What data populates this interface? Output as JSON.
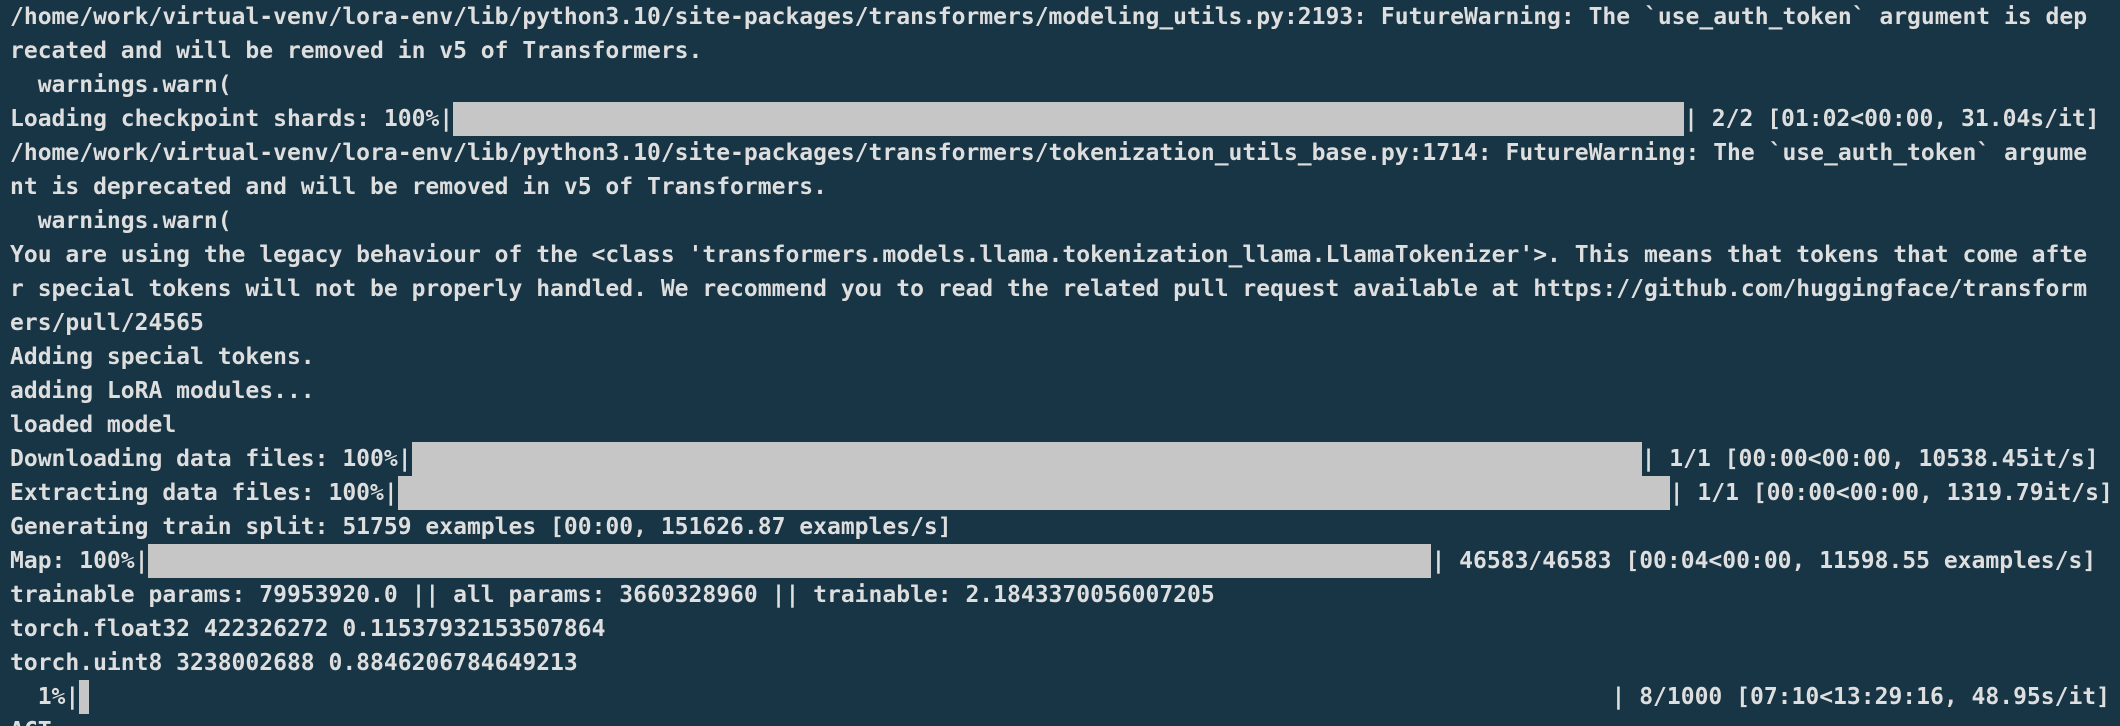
{
  "lines": {
    "l1": "/home/work/virtual-venv/lora-env/lib/python3.10/site-packages/transformers/modeling_utils.py:2193: FutureWarning: The `use_auth_token` argument is dep",
    "l2": "recated and will be removed in v5 of Transformers.",
    "l3": "  warnings.warn(",
    "l5": "/home/work/virtual-venv/lora-env/lib/python3.10/site-packages/transformers/tokenization_utils_base.py:1714: FutureWarning: The `use_auth_token` argume",
    "l6": "nt is deprecated and will be removed in v5 of Transformers.",
    "l7": "  warnings.warn(",
    "l8": "You are using the legacy behaviour of the <class 'transformers.models.llama.tokenization_llama.LlamaTokenizer'>. This means that tokens that come afte",
    "l9": "r special tokens will not be properly handled. We recommend you to read the related pull request available at https://github.com/huggingface/transform",
    "l10": "ers/pull/24565",
    "l11": "Adding special tokens.",
    "l12": "adding LoRA modules...",
    "l13": "loaded model",
    "l16": "Generating train split: 51759 examples [00:00, 151626.87 examples/s]",
    "l18": "trainable params: 79953920.0 || all params: 3660328960 || trainable: 2.1843370056007205",
    "l19": "torch.float32 422326272 0.11537932153507864",
    "l20": "torch.uint8 3238002688 0.8846206784649213",
    "l22": "ACT... "
  },
  "progress": {
    "checkpoint": {
      "prefix": "Loading checkpoint shards: 100%|",
      "suffix": "| 2/2 [01:02<00:00, 31.04s/it]",
      "fraction": 1.0
    },
    "download": {
      "prefix": "Downloading data files: 100%|",
      "suffix": "| 1/1 [00:00<00:00, 10538.45it/s]",
      "fraction": 1.0
    },
    "extract": {
      "prefix": "Extracting data files: 100%|",
      "suffix": "| 1/1 [00:00<00:00, 1319.79it/s]",
      "fraction": 1.0
    },
    "map": {
      "prefix": "Map: 100%|",
      "suffix": "| 46583/46583 [00:04<00:00, 11598.55 examples/s]",
      "fraction": 1.0
    },
    "train": {
      "prefix": "  1%|",
      "suffix": "| 8/1000 [07:10<13:29:16, 48.95s/it]",
      "fraction": 0.008
    }
  },
  "colors": {
    "background": "#173545",
    "text": "#dedede",
    "bar": "#c6c6c6"
  }
}
